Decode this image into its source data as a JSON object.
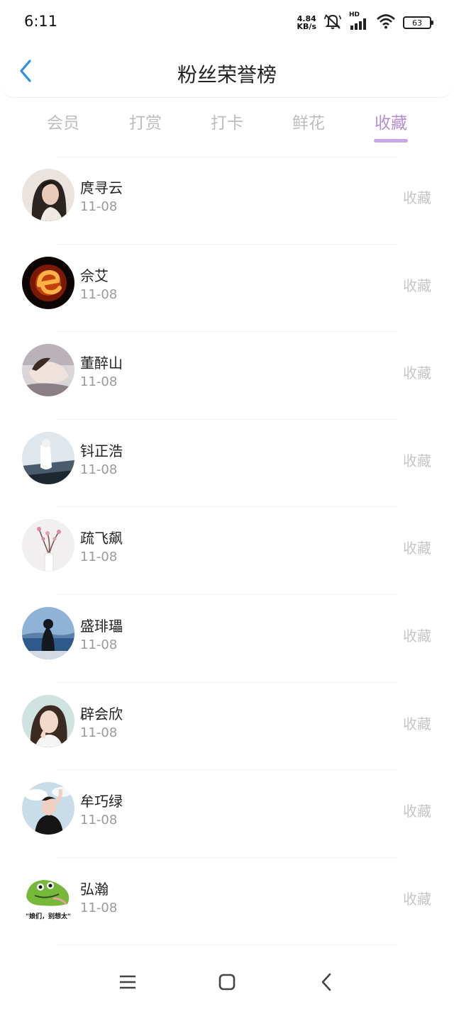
{
  "status_bar": {
    "time": "6:11",
    "net_speed_value": "4.84",
    "net_speed_unit": "KB/s",
    "signal_label": "HD",
    "battery": "63"
  },
  "header": {
    "title": "粉丝荣誉榜",
    "back_icon": "chevron-left-icon",
    "accent_color": "#2e8fe6"
  },
  "tabs": [
    {
      "label": "会员",
      "active": false
    },
    {
      "label": "打赏",
      "active": false
    },
    {
      "label": "打卡",
      "active": false
    },
    {
      "label": "鲜花",
      "active": false
    },
    {
      "label": "收藏",
      "active": true
    }
  ],
  "tab_active_color": "#b58fd6",
  "fans": [
    {
      "name": "庹寻云",
      "date": "11-08",
      "action": "收藏",
      "avatar": "portrait-woman-dark-hair"
    },
    {
      "name": "佘艾",
      "date": "11-08",
      "action": "收藏",
      "avatar": "fire-letter-e"
    },
    {
      "name": "董醉山",
      "date": "11-08",
      "action": "收藏",
      "avatar": "portrait-man-lying"
    },
    {
      "name": "钭正浩",
      "date": "11-08",
      "action": "收藏",
      "avatar": "white-figure-blue-sky"
    },
    {
      "name": "疏飞飙",
      "date": "11-08",
      "action": "收藏",
      "avatar": "pink-flower-vase"
    },
    {
      "name": "盛琲瓃",
      "date": "11-08",
      "action": "收藏",
      "avatar": "girl-by-lake"
    },
    {
      "name": "辟会欣",
      "date": "11-08",
      "action": "收藏",
      "avatar": "portrait-woman-white"
    },
    {
      "name": "牟巧绿",
      "date": "11-08",
      "action": "收藏",
      "avatar": "man-black-shirt-cloud"
    },
    {
      "name": "弘瀚",
      "date": "11-08",
      "action": "收藏",
      "avatar": "green-frog-meme",
      "avatar_caption": "\"娘们，别想太\""
    }
  ],
  "nav_bar": {
    "menu_icon": "menu-icon",
    "home_icon": "home-square-icon",
    "back_icon": "back-triangle-icon"
  }
}
